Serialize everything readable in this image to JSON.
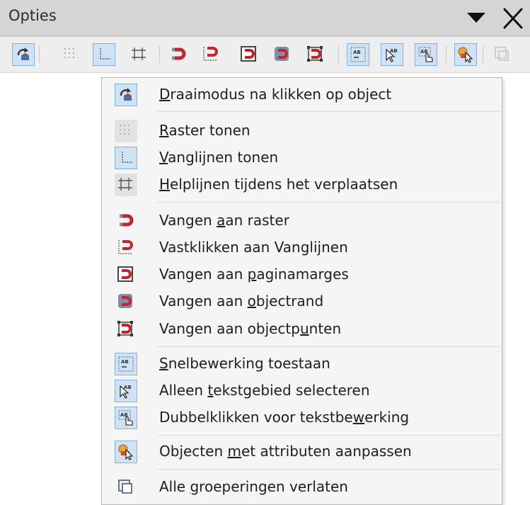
{
  "panel": {
    "title": "Opties"
  },
  "menu": {
    "items": [
      {
        "pre": "",
        "key": "D",
        "post": "raaimodus na klikken op object",
        "icon": "rotate-mode-icon",
        "active": true
      },
      {
        "pre": "",
        "key": "R",
        "post": "aster tonen",
        "icon": "grid-icon",
        "active": false
      },
      {
        "pre": "",
        "key": "V",
        "post": "anglijnen tonen",
        "icon": "snap-guides-icon",
        "active": false
      },
      {
        "pre": "",
        "key": "H",
        "post": "elplijnen tijdens het verplaatsen",
        "icon": "helplines-icon",
        "active": false
      },
      {
        "pre": "Vangen ",
        "key": "a",
        "post": "an raster",
        "icon": "snap-to-grid-icon",
        "active": false
      },
      {
        "pre": "Vastklikken aan Vanglijnen",
        "key": "",
        "post": "",
        "icon": "snap-to-guides-icon",
        "active": false
      },
      {
        "pre": "Vangen aan ",
        "key": "p",
        "post": "aginamarges",
        "icon": "snap-to-page-margins-icon",
        "active": false
      },
      {
        "pre": "Vangen aan ",
        "key": "o",
        "post": "bjectrand",
        "icon": "snap-to-object-border-icon",
        "active": false
      },
      {
        "pre": "Vangen aan objectp",
        "key": "u",
        "post": "nten",
        "icon": "snap-to-object-points-icon",
        "active": false
      },
      {
        "pre": "",
        "key": "S",
        "post": "nelbewerking toestaan",
        "icon": "quick-edit-icon",
        "active": false
      },
      {
        "pre": "Alleen ",
        "key": "t",
        "post": "ekstgebied selecteren",
        "icon": "select-text-area-only-icon",
        "active": false
      },
      {
        "pre": "Dubbelklikken voor tekstbe",
        "key": "w",
        "post": "erking",
        "icon": "double-click-text-edit-icon",
        "active": false
      },
      {
        "pre": "Objecten ",
        "key": "m",
        "post": "et attributen aanpassen",
        "icon": "modify-with-attributes-icon",
        "active": true
      },
      {
        "pre": "Alle ",
        "key": "g",
        "post": "roeperingen verlaten",
        "icon": "exit-all-groups-icon",
        "active": false
      }
    ]
  }
}
